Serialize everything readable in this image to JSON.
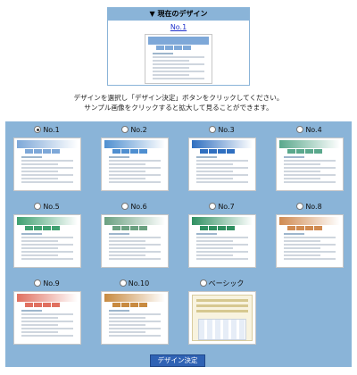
{
  "current": {
    "header": "▼ 現在のデザイン",
    "link": "No.1"
  },
  "instructions": {
    "line1": "デザインを選択し「デザイン決定」ボタンをクリックしてください。",
    "line2": "サンプル画像をクリックすると拡大して見ることができます。"
  },
  "designs": [
    {
      "label": "No.1",
      "selected": true,
      "color": "#7ea8d8"
    },
    {
      "label": "No.2",
      "selected": false,
      "color": "#4f8fd0"
    },
    {
      "label": "No.3",
      "selected": false,
      "color": "#2f6fc0"
    },
    {
      "label": "No.4",
      "selected": false,
      "color": "#5aa88c"
    },
    {
      "label": "No.5",
      "selected": false,
      "color": "#3fa070"
    },
    {
      "label": "No.6",
      "selected": false,
      "color": "#6aa080"
    },
    {
      "label": "No.7",
      "selected": false,
      "color": "#2f8f60"
    },
    {
      "label": "No.8",
      "selected": false,
      "color": "#d08a50"
    },
    {
      "label": "No.9",
      "selected": false,
      "color": "#e07060"
    },
    {
      "label": "No.10",
      "selected": false,
      "color": "#c88a40"
    },
    {
      "label": "ベーシック",
      "selected": false,
      "color": "#d6c890"
    }
  ],
  "submit_label": "デザイン決定"
}
